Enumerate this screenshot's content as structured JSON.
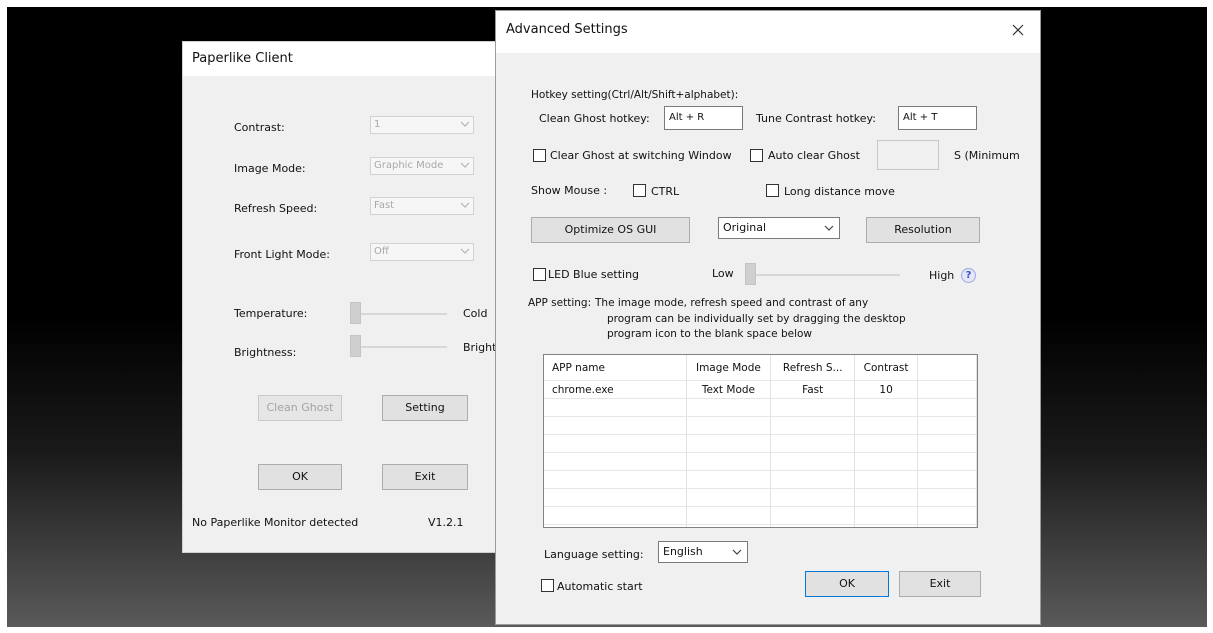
{
  "client": {
    "title": "Paperlike Client",
    "contrast": {
      "label": "Contrast:",
      "value": "1"
    },
    "image_mode": {
      "label": "Image Mode:",
      "value": "Graphic Mode"
    },
    "refresh_speed": {
      "label": "Refresh Speed:",
      "value": "Fast"
    },
    "front_light": {
      "label": "Front Light Mode:",
      "value": "Off"
    },
    "temperature": {
      "label": "Temperature:",
      "end_label": "Cold",
      "level": 0
    },
    "brightness": {
      "label": "Brightness:",
      "end_label": "Bright",
      "level": 0
    },
    "clean_ghost_label": "Clean Ghost",
    "setting_label": "Setting",
    "ok_label": "OK",
    "exit_label": "Exit",
    "status": "No Paperlike Monitor detected",
    "version": "V1.2.1"
  },
  "advanced": {
    "title": "Advanced Settings",
    "close_icon": "close-icon",
    "hotkey_heading": "Hotkey setting(Ctrl/Alt/Shift+alphabet):",
    "clean_ghost_hotkey_label": "Clean Ghost hotkey:",
    "clean_ghost_hotkey_value": "Alt + R",
    "tune_contrast_hotkey_label": "Tune Contrast hotkey:",
    "tune_contrast_hotkey_value": "Alt + T",
    "clear_ghost_switching_label": "Clear Ghost at switching Window",
    "auto_clear_ghost_label": "Auto clear Ghost",
    "auto_clear_seconds_value": "",
    "auto_clear_suffix": "S (Minimum",
    "show_mouse_label": "Show Mouse :",
    "ctrl_label": "CTRL",
    "long_distance_label": "Long distance move",
    "optimize_label": "Optimize OS GUI",
    "resolution_select_value": "Original",
    "resolution_label": "Resolution",
    "led_blue_label": "LED Blue setting",
    "led_low_label": "Low",
    "led_high_label": "High",
    "led_level": 0,
    "help_glyph": "?",
    "app_setting_label": "APP setting:",
    "app_setting_desc_1": "The image mode, refresh speed and contrast of any",
    "app_setting_desc_2": "program can be individually set by dragging the desktop",
    "app_setting_desc_3": "program icon to the blank space below",
    "table": {
      "headers": [
        "APP name",
        "Image Mode",
        "Refresh S...",
        "Contrast"
      ],
      "rows": [
        [
          "chrome.exe",
          "Text Mode",
          "Fast",
          "10"
        ]
      ]
    },
    "language_label": "Language setting:",
    "language_value": "English",
    "auto_start_label": "Automatic start",
    "ok_label": "OK",
    "exit_label": "Exit"
  }
}
